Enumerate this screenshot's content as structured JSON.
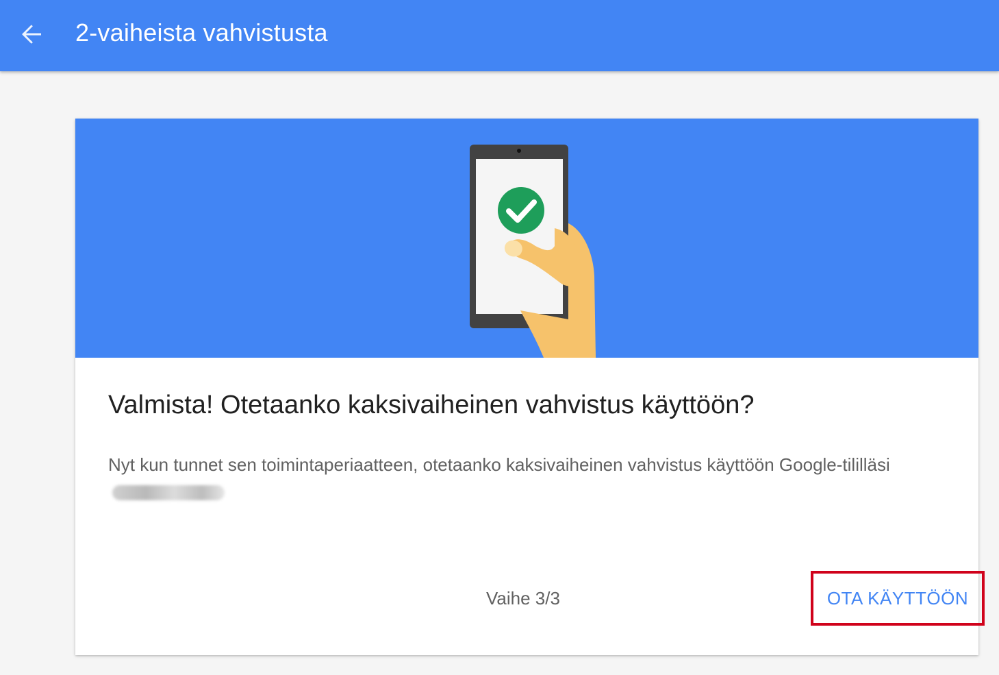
{
  "topbar": {
    "back_icon": "arrow-left-icon",
    "title": "2-vaiheista vahvistusta"
  },
  "card": {
    "illustration": "phone-checkmark-hand",
    "title": "Valmista! Otetaanko kaksivaiheinen vahvistus käyttöön?",
    "body": "Nyt kun tunnet sen toimintaperiaatteen, otetaanko kaksivaiheinen vahvistus käyttöön Google-tililläsi",
    "step_label": "Vaihe 3/3",
    "enable_button": "OTA KÄYTTÖÖN"
  },
  "colors": {
    "primary": "#4285f4",
    "success": "#1e9e5a",
    "highlight_border": "#d0021b"
  }
}
